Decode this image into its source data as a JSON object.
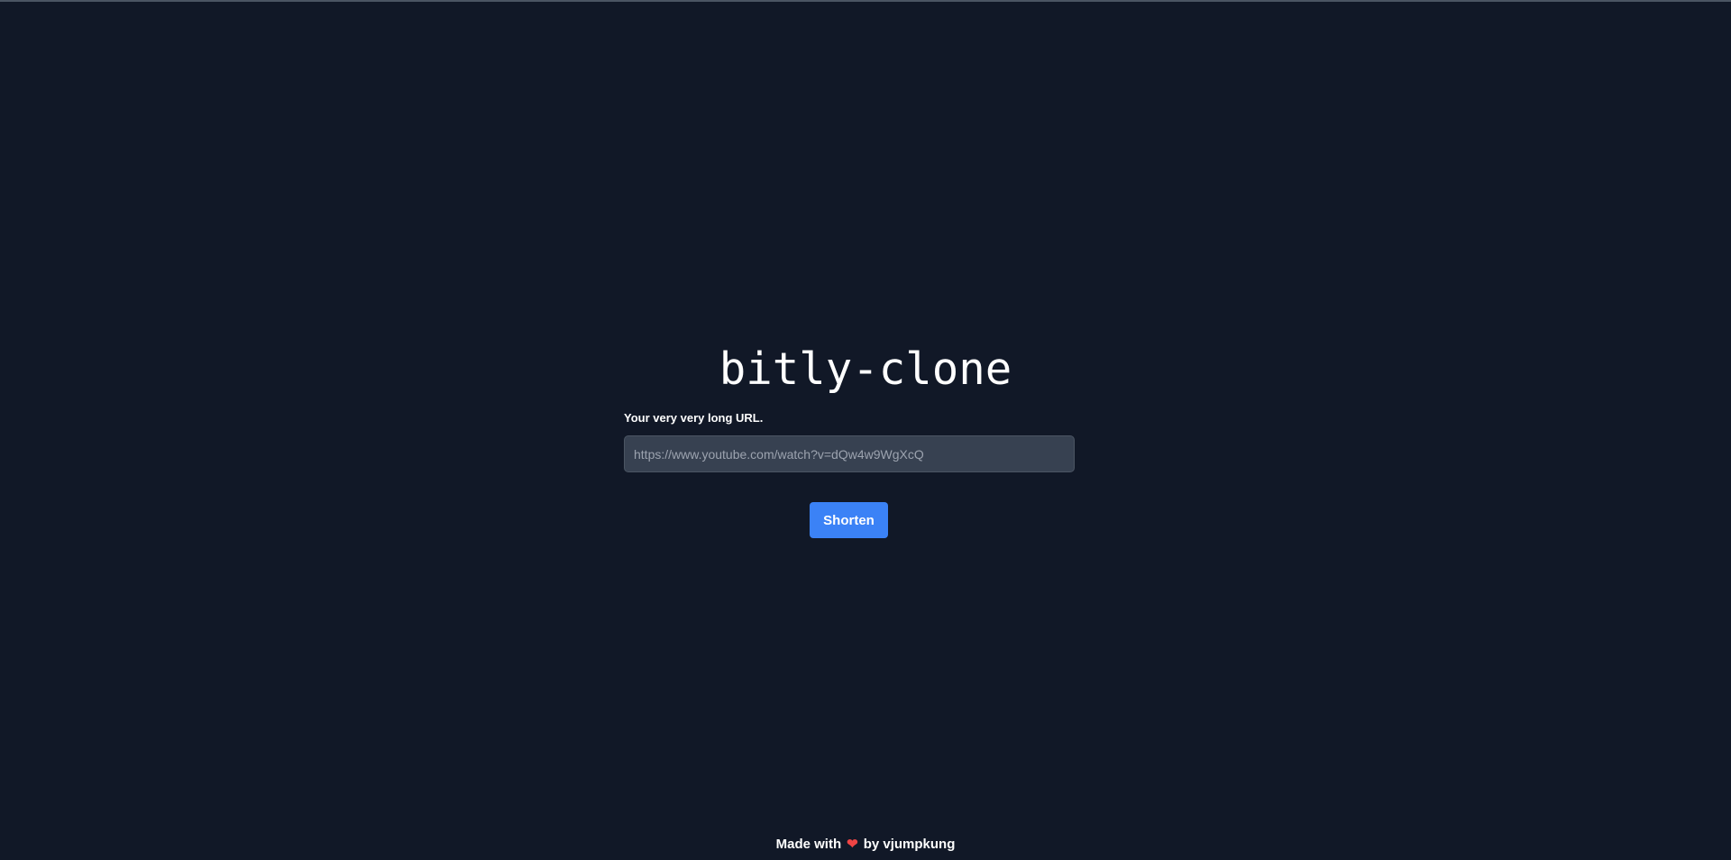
{
  "app": {
    "title": "bitly-clone"
  },
  "form": {
    "label": "Your very very long URL.",
    "url_value": "",
    "url_placeholder": "https://www.youtube.com/watch?v=dQw4w9WgXcQ",
    "submit_label": "Shorten"
  },
  "footer": {
    "prefix": "Made with",
    "icon": "heart-icon",
    "suffix": "by vjumpkung"
  },
  "colors": {
    "background": "#111827",
    "accent": "#3b82f6",
    "heart": "#ef4444"
  }
}
